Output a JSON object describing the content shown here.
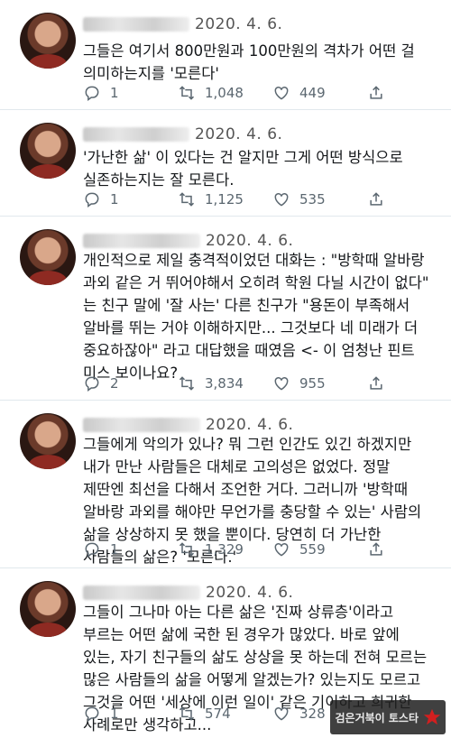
{
  "tweets": [
    {
      "date": "2020. 4. 6.",
      "text": "그들은 여기서 800만원과 100만원의 격차가 어떤 걸 의미하는지를 '모른다'",
      "replies": "1",
      "retweets": "1,048",
      "likes": "449"
    },
    {
      "date": "2020. 4. 6.",
      "text": "'가난한 삶' 이 있다는 건 알지만 그게 어떤 방식으로 실존하는지는 잘 모른다.",
      "replies": "1",
      "retweets": "1,125",
      "likes": "535"
    },
    {
      "date": "2020. 4. 6.",
      "text": "개인적으로 제일 충격적이었던 대화는 : \"방학때 알바랑 과외 같은 거 뛰어야해서 오히려 학원 다닐 시간이 없다\" 는 친구 말에 '잘 사는' 다른 친구가 \"용돈이 부족해서 알바를 뛰는 거야 이해하지만... 그것보다 네 미래가 더 중요하잖아\" 라고 대답했을 때였음 <- 이 엄청난 핀트 미스 보이나요?",
      "replies": "2",
      "retweets": "3,834",
      "likes": "955"
    },
    {
      "date": "2020. 4. 6.",
      "text": "그들에게 악의가 있나? 뭐 그런 인간도 있긴 하겠지만 내가 만난 사람들은 대체로 고의성은 없었다. 정말 제딴엔 최선을 다해서 조언한 거다. 그러니까 '방학때 알바랑 과외를 해야만 무언가를 충당할 수 있는' 사람의 삶을 상상하지 못 했을 뿐이다. 당연히 더 가난한 사람들의 삶은? '모른다.'",
      "replies": "1",
      "retweets": "1,329",
      "likes": "559"
    },
    {
      "date": "2020. 4. 6.",
      "text": "그들이 그나마 아는 다른 삶은 '진짜 상류층'이라고 부르는 어떤 삶에 국한 된 경우가 많았다. 바로 앞에 있는, 자기 친구들의 삶도 상상을 못 하는데 전혀 모르는 많은 사람들의 삶을 어떻게 알겠는가? 있는지도 모르고 그것을 어떤 '세상에 이런 일이' 같은 기이하고 희귀한 사례로만 생각하고...",
      "replies": "1",
      "retweets": "574",
      "likes": "328"
    }
  ],
  "watermark": {
    "text": "검은거북이 토스타"
  },
  "colors": {
    "text": "#14171a",
    "muted": "#5b6770",
    "divider": "#e1e8ed"
  }
}
